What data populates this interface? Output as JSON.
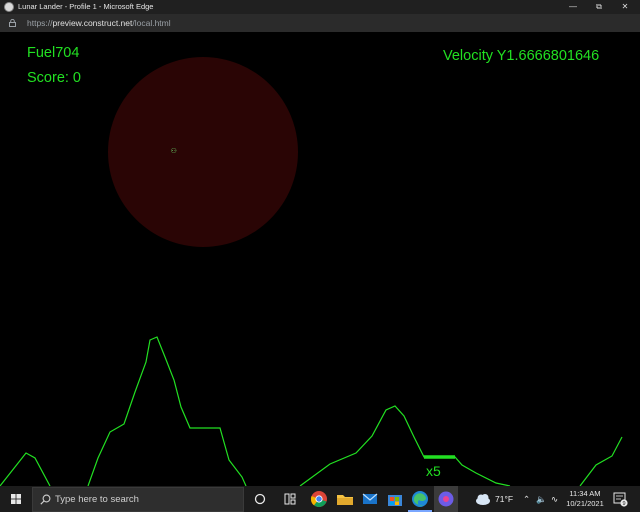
{
  "window": {
    "title": "Lunar Lander - Profile 1 - Microsoft Edge",
    "url_prefix": "https://",
    "url_host": "preview.construct.net",
    "url_path": "/local.html"
  },
  "hud": {
    "fuel": "Fuel704",
    "score": "Score: 0",
    "velocity": "Velocity Y1.6666801646"
  },
  "game": {
    "lander_glyph": "⚇",
    "landing_pad_multiplier": "x5",
    "colors": {
      "terrain": "#22e022",
      "hud_text": "#22e022",
      "danger_zone": "#2a0505",
      "background": "#000000"
    }
  },
  "taskbar": {
    "search_placeholder": "Type here to search",
    "pinned": [
      "task-view-icon",
      "widgets-icon",
      "chrome-icon",
      "file-explorer-icon",
      "mail-icon",
      "store-icon",
      "edge-icon",
      "app-icon"
    ],
    "weather": "71°F",
    "time": "11:34 AM",
    "date": "10/21/2021",
    "notification_count": "9"
  }
}
